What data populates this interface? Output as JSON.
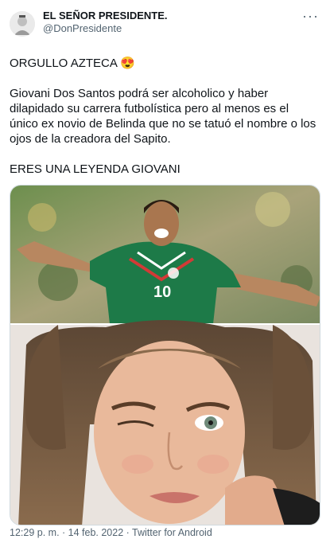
{
  "tweet": {
    "display_name": "EL SEÑOR PRESIDENTE.",
    "handle": "@DonPresidente",
    "more_label": "···",
    "line1": "ORGULLO AZTECA",
    "emoji": "😍",
    "body": "Giovani Dos Santos podrá ser alcoholico y haber dilapidado su carrera futbolística pero al menos es el único ex novio de Belinda que no se tatuó el nombre o los ojos de la creadora del Sapito.",
    "closing": "ERES UNA LEYENDA GIOVANI",
    "jersey_number": "10",
    "timestamp": "12:29 p. m. · 14 feb. 2022 · Twitter for Android"
  }
}
